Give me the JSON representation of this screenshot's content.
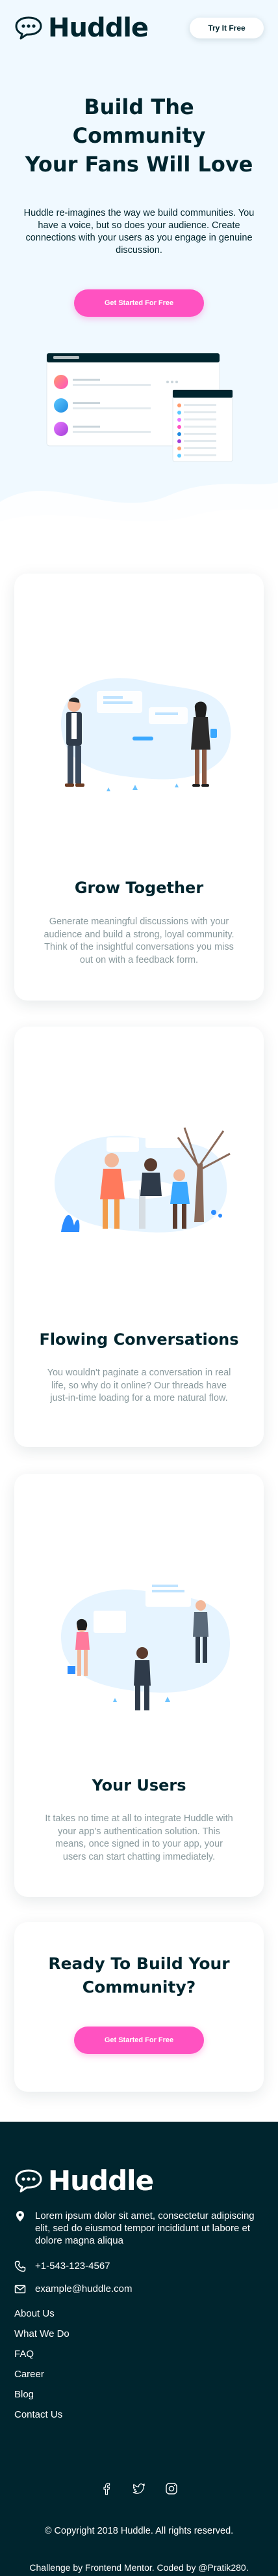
{
  "header": {
    "logo_text": "Huddle",
    "try_button": "Try It Free"
  },
  "hero": {
    "title_lines": [
      "Build The",
      "Community",
      "Your Fans Will Love"
    ],
    "description": "Huddle re-imagines the way we build communities. You have a voice, but so does your audience. Create connections with your users as you engage in genuine discussion.",
    "cta": "Get Started For Free"
  },
  "features": [
    {
      "title": "Grow Together",
      "text": "Generate meaningful discussions with your audience and build a strong, loyal community. Think of the insightful conversations you miss out on with a feedback form."
    },
    {
      "title": "Flowing Conversations",
      "text": "You wouldn't paginate a conversation in real life, so why do it online? Our threads have just-in-time loading for a more natural flow."
    },
    {
      "title": "Your Users",
      "text": "It takes no time at all to integrate Huddle with your app's authentication solution. This means, once signed in to your app, your users can start chatting immediately."
    }
  ],
  "cta_card": {
    "title_lines": [
      "Ready To Build Your",
      "Community?"
    ],
    "button": "Get Started For Free"
  },
  "footer": {
    "logo_text": "Huddle",
    "address": "Lorem ipsum dolor sit amet, consectetur adipiscing elit, sed do eiusmod tempor incididunt ut labore et dolore magna aliqua",
    "phone": "+1-543-123-4567",
    "email": "example@huddle.com",
    "nav": [
      "About Us",
      "What We Do",
      "FAQ",
      "Career",
      "Blog",
      "Contact Us"
    ],
    "copyright": "© Copyright 2018 Huddle. All rights reserved.",
    "credit": "Challenge by Frontend Mentor. Coded by @Pratik280."
  },
  "icons": {
    "logo": "chat-bubble-icon",
    "address": "location-pin-icon",
    "phone": "phone-icon",
    "email": "mail-icon",
    "socials": [
      "facebook-icon",
      "twitter-icon",
      "instagram-icon"
    ]
  },
  "colors": {
    "primary_dark": "#00252e",
    "accent_pink": "#ff52c1",
    "hero_bg": "#f0f9ff",
    "text_muted": "#8a9a9e"
  }
}
